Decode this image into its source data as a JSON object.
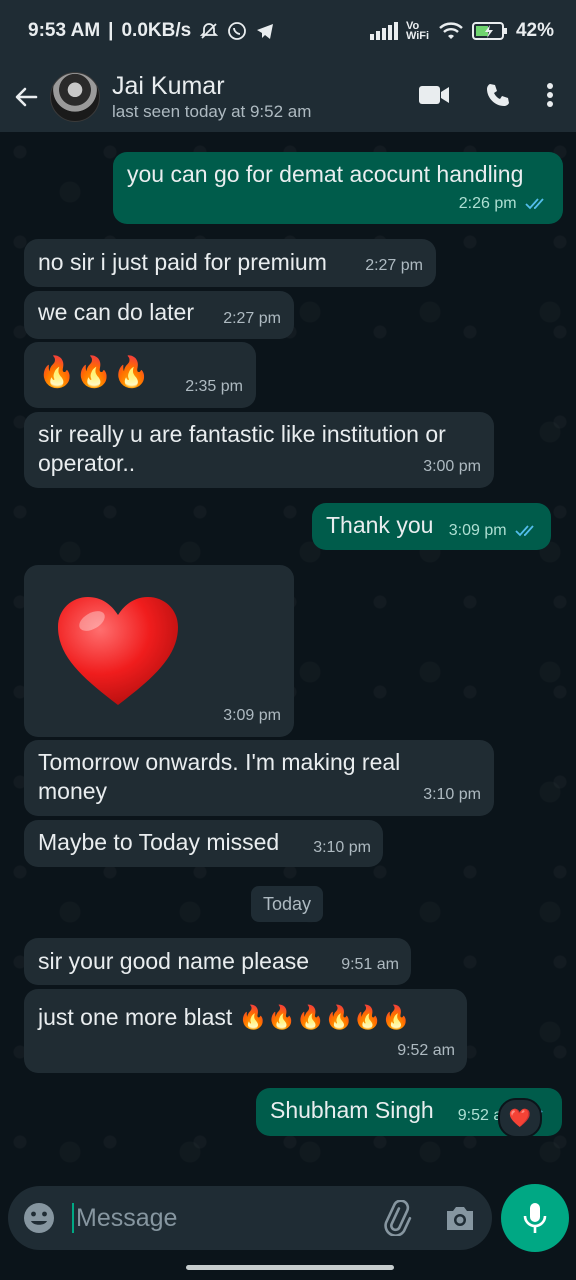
{
  "status": {
    "time": "9:53 AM",
    "speed": "0.0KB/s",
    "volte": "Vo WiFi",
    "battery": "42%"
  },
  "header": {
    "contact_name": "Jai Kumar",
    "last_seen": "last seen today at 9:52 am"
  },
  "messages": [
    {
      "dir": "out",
      "text": "you can go for demat acocunt handling",
      "time": "2:26 pm"
    },
    {
      "dir": "in",
      "text": "no sir i just paid for premium",
      "time": "2:27 pm"
    },
    {
      "dir": "in",
      "text": "we can do later",
      "time": "2:27 pm"
    },
    {
      "dir": "in",
      "text": "🔥🔥🔥",
      "time": "2:35 pm"
    },
    {
      "dir": "in",
      "text": "sir really u are fantastic like institution or operator..",
      "time": "3:00 pm"
    },
    {
      "dir": "out",
      "text": "Thank you",
      "time": "3:09 pm"
    },
    {
      "dir": "in",
      "text": "❤",
      "time": "3:09 pm"
    },
    {
      "dir": "in",
      "text": "Tomorrow onwards. I'm making real money",
      "time": "3:10 pm"
    },
    {
      "dir": "in",
      "text": "Maybe to Today missed",
      "time": "3:10 pm"
    },
    {
      "dir": "in",
      "text": "sir your good name please",
      "time": "9:51 am"
    },
    {
      "dir": "in",
      "text": "just one more blast 🔥🔥🔥🔥🔥🔥",
      "time": "9:52 am"
    },
    {
      "dir": "out",
      "text": "Shubham Singh",
      "time": "9:52 am"
    }
  ],
  "day_divider": "Today",
  "reaction": "❤️",
  "composer": {
    "placeholder": "Message"
  },
  "colors": {
    "incoming_bubble": "#202c33",
    "outgoing_bubble": "#005c4b",
    "accent": "#00a884",
    "read_ticks": "#53bdeb"
  }
}
